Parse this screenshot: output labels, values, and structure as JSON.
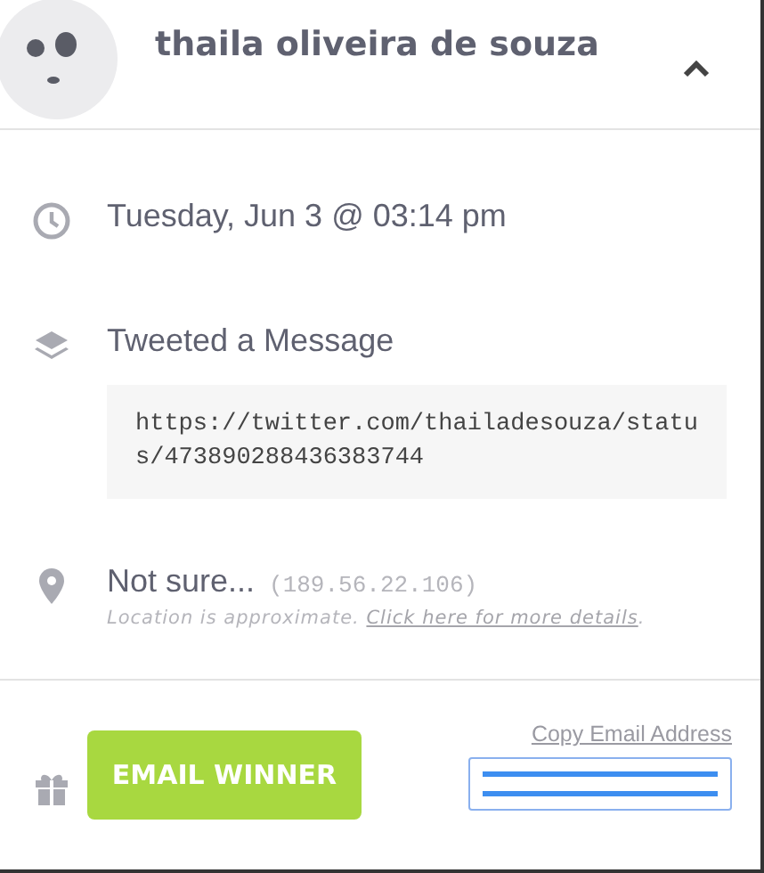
{
  "header": {
    "name": "thaila oliveira de souza",
    "expanded": true
  },
  "entries": [
    {
      "kind": "time",
      "text": "Tuesday, Jun 3 @ 03:14 pm"
    },
    {
      "kind": "action",
      "text": "Tweeted a Message",
      "code": "https://twitter.com/thailadesouza/status/473890288436383744"
    },
    {
      "kind": "location",
      "text": "Not sure...",
      "ip": "(189.56.22.106)",
      "note": "Location is approximate.",
      "link": "Click here for more details",
      "after": "."
    }
  ],
  "footer": {
    "button": "EMAIL WINNER",
    "copy_link": "Copy Email Address"
  }
}
